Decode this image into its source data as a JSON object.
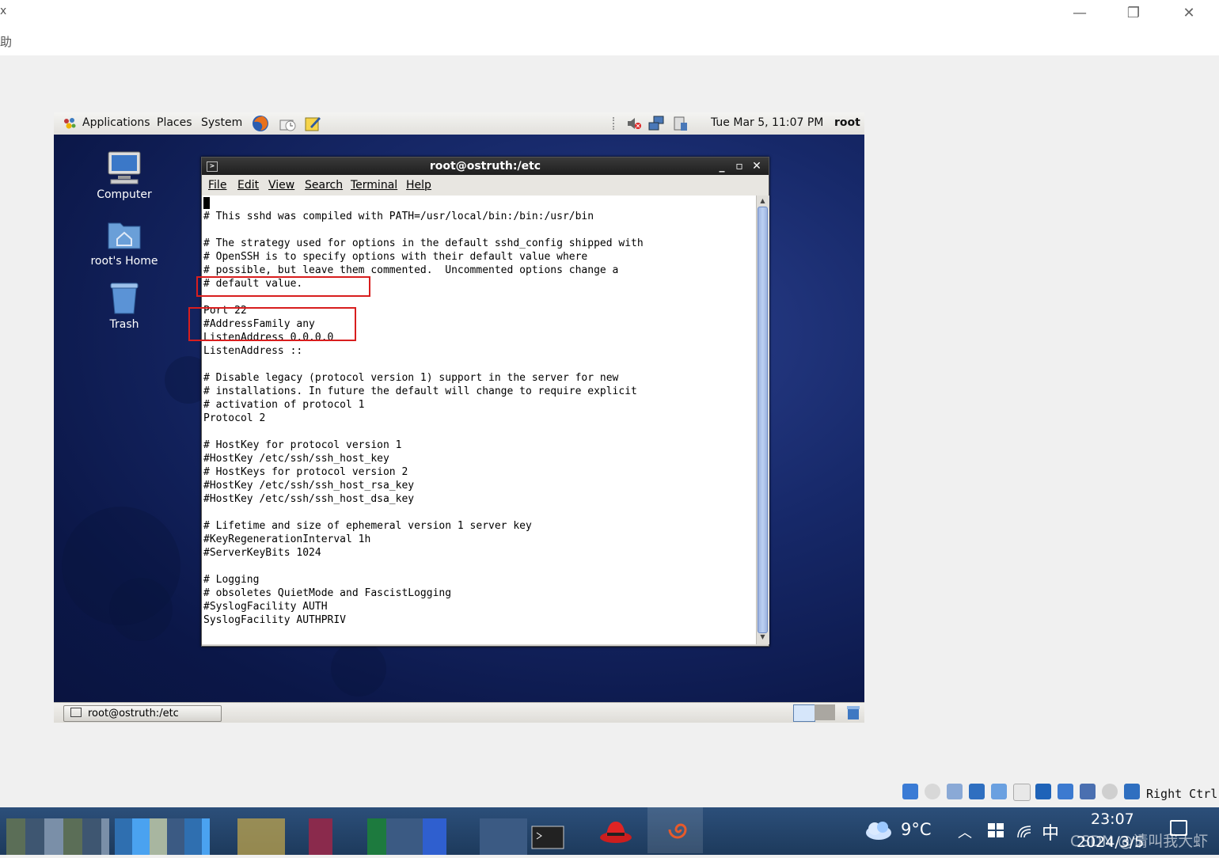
{
  "host": {
    "edge_label_1": "x",
    "edge_label_2": "助",
    "controls": {
      "minimize": "—",
      "restore": "❐",
      "close": "✕"
    }
  },
  "gnome_panel": {
    "menus": [
      "Applications",
      "Places",
      "System"
    ],
    "clock": "Tue Mar  5, 11:07 PM",
    "user": "root"
  },
  "desktop": {
    "icons": [
      {
        "label": "Computer",
        "icon": "computer-icon"
      },
      {
        "label": "root's Home",
        "icon": "home-folder-icon"
      },
      {
        "label": "Trash",
        "icon": "trash-icon"
      }
    ]
  },
  "terminal": {
    "title": "root@ostruth:/etc",
    "menus": [
      "File",
      "Edit",
      "View",
      "Search",
      "Terminal",
      "Help"
    ],
    "lines": [
      "",
      "# This sshd was compiled with PATH=/usr/local/bin:/bin:/usr/bin",
      "",
      "# The strategy used for options in the default sshd_config shipped with",
      "# OpenSSH is to specify options with their default value where",
      "# possible, but leave them commented.  Uncommented options change a",
      "# default value.",
      "",
      "Port 22",
      "#AddressFamily any",
      "ListenAddress 0.0.0.0",
      "ListenAddress ::",
      "",
      "# Disable legacy (protocol version 1) support in the server for new",
      "# installations. In future the default will change to require explicit",
      "# activation of protocol 1",
      "Protocol 2",
      "",
      "# HostKey for protocol version 1",
      "#HostKey /etc/ssh/ssh_host_key",
      "# HostKeys for protocol version 2",
      "#HostKey /etc/ssh/ssh_host_rsa_key",
      "#HostKey /etc/ssh/ssh_host_dsa_key",
      "",
      "# Lifetime and size of ephemeral version 1 server key",
      "#KeyRegenerationInterval 1h",
      "#ServerKeyBits 1024",
      "",
      "# Logging",
      "# obsoletes QuietMode and FascistLogging",
      "#SyslogFacility AUTH",
      "SyslogFacility AUTHPRIV"
    ]
  },
  "bottom_panel": {
    "task": "root@ostruth:/etc"
  },
  "vbox": {
    "host_key": "Right Ctrl"
  },
  "windows_taskbar": {
    "weather": "9°C",
    "ime": "中",
    "time": "23:07",
    "date": "2024/3/5",
    "watermark": "CSDN @请叫我大虾"
  },
  "colors": {
    "annotation": "#d81e1e",
    "desktop": "#17296a",
    "taskbar": "#1d3a5c"
  }
}
